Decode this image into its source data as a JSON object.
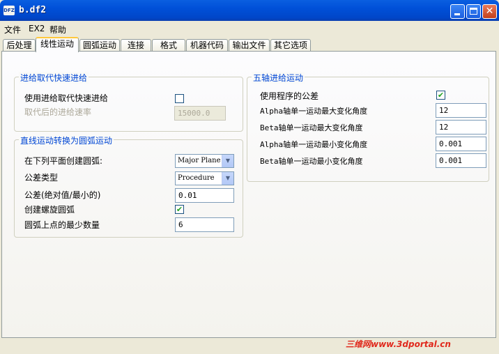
{
  "window": {
    "title": "b.df2",
    "icon_text": "DFZ"
  },
  "menu": [
    "文件",
    "EX2",
    "帮助"
  ],
  "tabs": [
    "后处理",
    "线性运动",
    "圆弧运动",
    "连接",
    "格式",
    "机器代码",
    "输出文件",
    "其它选项"
  ],
  "active_tab": 1,
  "feed_group": {
    "title": "进给取代快速进给",
    "use_feed_label": "使用进给取代快速进给",
    "use_feed_checked": false,
    "feed_rate_label": "取代后的进给速率",
    "feed_rate_value": "15000.0"
  },
  "arc_group": {
    "title": "直线运动转换为圆弧运动",
    "plane_label": "在下列平面创建圆弧:",
    "plane_value": "Major Plane",
    "tolerance_type_label": "公差类型",
    "tolerance_type_value": "Procedure",
    "tolerance_label": "公差(绝对值/最小的)",
    "tolerance_value": "0.01",
    "helix_label": "创建螺旋圆弧",
    "helix_checked": true,
    "min_points_label": "圆弧上点的最少数量",
    "min_points_value": "6"
  },
  "five_axis_group": {
    "title": "五轴进给运动",
    "use_program_tol_label": "使用程序的公差",
    "use_program_tol_checked": true,
    "alpha_max_label": "Alpha轴单一运动最大变化角度",
    "alpha_max_value": "12",
    "beta_max_label": "Beta轴单一运动最大变化角度",
    "beta_max_value": "12",
    "alpha_min_label": "Alpha轴单一运动最小变化角度",
    "alpha_min_value": "0.001",
    "beta_min_label": "Beta轴单一运动最小变化角度",
    "beta_min_value": "0.001"
  },
  "watermark": "三维网www.3dportal.cn",
  "colors": {
    "title_bar": "#0050d8",
    "group_title": "#0046d5",
    "check": "#21a121",
    "watermark": "#e0281c"
  }
}
